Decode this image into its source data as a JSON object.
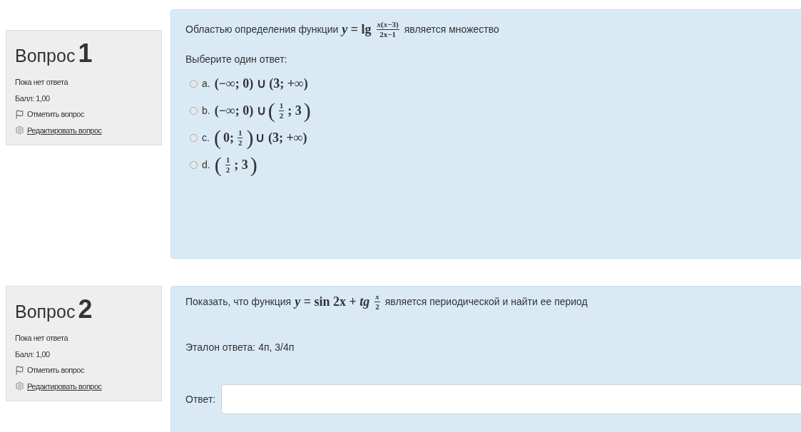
{
  "questions": [
    {
      "label": "Вопрос",
      "number": "1",
      "status": "Пока нет ответа",
      "score": "Балл: 1,00",
      "flag_link": "Отметить вопрос",
      "edit_link": "Редактировать вопрос",
      "prompt": [
        {
          "kind": "text",
          "text": "Областью определения функции"
        },
        {
          "kind": "math",
          "text": "*y* = lg"
        },
        {
          "kind": "frac",
          "num": "*x*(*x*−3)",
          "den": "2x−1"
        },
        {
          "kind": "text",
          "text": "является множество"
        }
      ],
      "instruction": "Выберите один ответ:",
      "options": [
        {
          "letter": "a.",
          "selected": false,
          "math": [
            {
              "kind": "math",
              "text": "(−∞; 0) ∪ (3; +∞)"
            }
          ]
        },
        {
          "letter": "b.",
          "selected": false,
          "math": [
            {
              "kind": "math",
              "text": "(−∞; 0) ∪"
            },
            {
              "kind": "paren",
              "text": "("
            },
            {
              "kind": "frac",
              "num": "1",
              "den": "2"
            },
            {
              "kind": "math",
              "text": "; 3"
            },
            {
              "kind": "paren",
              "text": ")"
            }
          ]
        },
        {
          "letter": "c.",
          "selected": false,
          "math": [
            {
              "kind": "paren",
              "text": "("
            },
            {
              "kind": "math",
              "text": "0;"
            },
            {
              "kind": "frac",
              "num": "1",
              "den": "2"
            },
            {
              "kind": "paren",
              "text": ")"
            },
            {
              "kind": "math",
              "text": "∪ (3; +∞)"
            }
          ]
        },
        {
          "letter": "d.",
          "selected": false,
          "math": [
            {
              "kind": "paren",
              "text": "("
            },
            {
              "kind": "frac",
              "num": "1",
              "den": "2"
            },
            {
              "kind": "math",
              "text": "; 3"
            },
            {
              "kind": "paren",
              "text": ")"
            }
          ]
        }
      ]
    },
    {
      "label": "Вопрос",
      "number": "2",
      "status": "Пока нет ответа",
      "score": "Балл: 1,00",
      "flag_link": "Отметить вопрос",
      "edit_link": "Редактировать вопрос",
      "prompt": [
        {
          "kind": "text",
          "text": "Показать, что функция"
        },
        {
          "kind": "math",
          "text": "*y* = sin 2x + *tg*"
        },
        {
          "kind": "frac",
          "num": "*x*",
          "den": "2"
        },
        {
          "kind": "text",
          "text": "является периодической и найти ее период"
        }
      ],
      "reference": "Эталон ответа: 4п, 3/4п",
      "answer_label": "Ответ:"
    }
  ]
}
